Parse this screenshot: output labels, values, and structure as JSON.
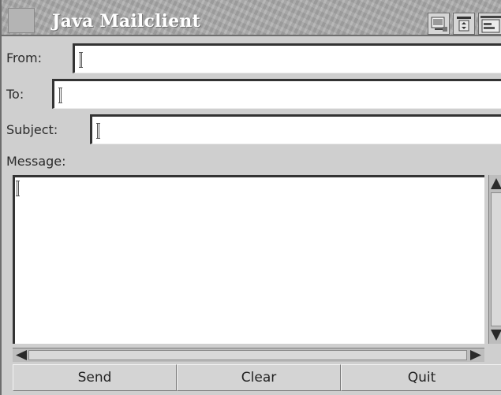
{
  "window": {
    "title": "Java Mailclient"
  },
  "form": {
    "from_label": "From:",
    "from_value": "",
    "to_label": "To:",
    "to_value": "",
    "subject_label": "Subject:",
    "subject_value": "",
    "message_label": "Message:",
    "message_value": ""
  },
  "buttons": {
    "send": "Send",
    "clear": "Clear",
    "quit": "Quit"
  },
  "icons": {
    "window_menu": "window-menu-icon",
    "minimize": "minimize-icon",
    "maximize": "maximize-icon",
    "scroll_up": "arrow-up-icon",
    "scroll_down": "arrow-down-icon",
    "scroll_left": "arrow-left-icon",
    "scroll_right": "arrow-right-icon"
  }
}
